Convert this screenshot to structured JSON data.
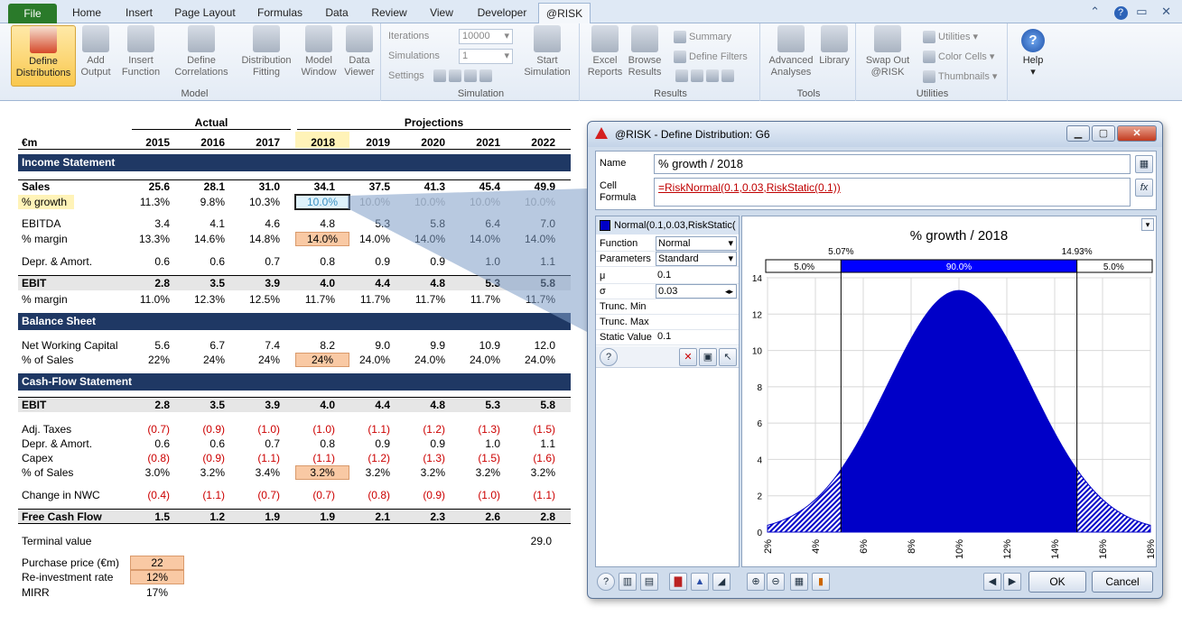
{
  "ribbon": {
    "tabs": [
      "File",
      "Home",
      "Insert",
      "Page Layout",
      "Formulas",
      "Data",
      "Review",
      "View",
      "Developer",
      "@RISK"
    ],
    "groups": {
      "model": {
        "label": "Model",
        "define_distributions": "Define Distributions",
        "add_output": "Add Output",
        "insert_function": "Insert Function",
        "define_correlations": "Define Correlations",
        "distribution_fitting": "Distribution Fitting",
        "model_window": "Model Window",
        "data_viewer": "Data Viewer"
      },
      "simulation": {
        "label": "Simulation",
        "iterations_label": "Iterations",
        "iterations_value": "10000",
        "simulations_label": "Simulations",
        "simulations_value": "1",
        "settings_label": "Settings",
        "start_simulation": "Start Simulation"
      },
      "results": {
        "label": "Results",
        "excel_reports": "Excel Reports",
        "browse_results": "Browse Results",
        "summary": "Summary",
        "define_filters": "Define Filters"
      },
      "tools": {
        "label": "Tools",
        "advanced_analyses": "Advanced Analyses",
        "library": "Library"
      },
      "utilities": {
        "label": "Utilities",
        "swap_out": "Swap Out @RISK",
        "utilities": "Utilities",
        "color_cells": "Color Cells",
        "thumbnails": "Thumbnails"
      },
      "help": {
        "label": "Help"
      }
    }
  },
  "sheet": {
    "header_actual": "Actual",
    "header_projections": "Projections",
    "unit": "€m",
    "years": [
      "2015",
      "2016",
      "2017",
      "2018",
      "2019",
      "2020",
      "2021",
      "2022"
    ],
    "income_statement": "Income Statement",
    "sales": {
      "label": "Sales",
      "values": [
        "25.6",
        "28.1",
        "31.0",
        "34.1",
        "37.5",
        "41.3",
        "45.4",
        "49.9"
      ]
    },
    "growth": {
      "label": "% growth",
      "values": [
        "11.3%",
        "9.8%",
        "10.3%",
        "10.0%",
        "10.0%",
        "10.0%",
        "10.0%",
        "10.0%"
      ]
    },
    "ebitda": {
      "label": "EBITDA",
      "values": [
        "3.4",
        "4.1",
        "4.6",
        "4.8",
        "5.3",
        "5.8",
        "6.4",
        "7.0"
      ]
    },
    "ebitda_margin": {
      "label": "% margin",
      "values": [
        "13.3%",
        "14.6%",
        "14.8%",
        "14.0%",
        "14.0%",
        "14.0%",
        "14.0%",
        "14.0%"
      ]
    },
    "depr": {
      "label": "Depr. & Amort.",
      "values": [
        "0.6",
        "0.6",
        "0.7",
        "0.8",
        "0.9",
        "0.9",
        "1.0",
        "1.1"
      ]
    },
    "ebit": {
      "label": "EBIT",
      "values": [
        "2.8",
        "3.5",
        "3.9",
        "4.0",
        "4.4",
        "4.8",
        "5.3",
        "5.8"
      ]
    },
    "ebit_margin": {
      "label": "% margin",
      "values": [
        "11.0%",
        "12.3%",
        "12.5%",
        "11.7%",
        "11.7%",
        "11.7%",
        "11.7%",
        "11.7%"
      ]
    },
    "balance_sheet": "Balance Sheet",
    "nwc": {
      "label": "Net Working Capital",
      "values": [
        "5.6",
        "6.7",
        "7.4",
        "8.2",
        "9.0",
        "9.9",
        "10.9",
        "12.0"
      ]
    },
    "nwc_pct": {
      "label": "% of Sales",
      "values": [
        "22%",
        "24%",
        "24%",
        "24%",
        "24.0%",
        "24.0%",
        "24.0%",
        "24.0%"
      ]
    },
    "cash_flow_statement": "Cash-Flow Statement",
    "cf_ebit": {
      "label": "EBIT",
      "values": [
        "2.8",
        "3.5",
        "3.9",
        "4.0",
        "4.4",
        "4.8",
        "5.3",
        "5.8"
      ]
    },
    "adj_taxes": {
      "label": "Adj. Taxes",
      "values": [
        "(0.7)",
        "(0.9)",
        "(1.0)",
        "(1.0)",
        "(1.1)",
        "(1.2)",
        "(1.3)",
        "(1.5)"
      ]
    },
    "cf_depr": {
      "label": "Depr. & Amort.",
      "values": [
        "0.6",
        "0.6",
        "0.7",
        "0.8",
        "0.9",
        "0.9",
        "1.0",
        "1.1"
      ]
    },
    "capex": {
      "label": "Capex",
      "values": [
        "(0.8)",
        "(0.9)",
        "(1.1)",
        "(1.1)",
        "(1.2)",
        "(1.3)",
        "(1.5)",
        "(1.6)"
      ]
    },
    "capex_pct": {
      "label": "% of Sales",
      "values": [
        "3.0%",
        "3.2%",
        "3.4%",
        "3.2%",
        "3.2%",
        "3.2%",
        "3.2%",
        "3.2%"
      ]
    },
    "change_nwc": {
      "label": "Change in NWC",
      "values": [
        "(0.4)",
        "(1.1)",
        "(0.7)",
        "(0.7)",
        "(0.8)",
        "(0.9)",
        "(1.0)",
        "(1.1)"
      ]
    },
    "fcf": {
      "label": "Free Cash Flow",
      "values": [
        "1.5",
        "1.2",
        "1.9",
        "1.9",
        "2.1",
        "2.3",
        "2.6",
        "2.8"
      ]
    },
    "terminal_value": {
      "label": "Terminal value",
      "value": "29.0"
    },
    "purchase_price": {
      "label": "Purchase price (€m)",
      "value": "22"
    },
    "reinvestment_rate": {
      "label": "Re-investment rate",
      "value": "12%"
    },
    "mirr": {
      "label": "MIRR",
      "value": "17%"
    }
  },
  "dialog": {
    "title": "@RISK - Define Distribution: G6",
    "name_label": "Name",
    "name_value": "% growth / 2018",
    "formula_label": "Cell Formula",
    "formula_value": "=RiskNormal(0.1,0.03,RiskStatic(0.1))",
    "dist_header": "Normal(0.1,0.03,RiskStatic(",
    "params": {
      "function_label": "Function",
      "function_value": "Normal",
      "parameters_label": "Parameters",
      "parameters_value": "Standard",
      "mu_label": "μ",
      "mu_value": "0.1",
      "sigma_label": "σ",
      "sigma_value": "0.03",
      "trunc_min_label": "Trunc. Min",
      "trunc_min_value": "",
      "trunc_max_label": "Trunc. Max",
      "trunc_max_value": "",
      "static_label": "Static Value",
      "static_value": "0.1"
    },
    "ok": "OK",
    "cancel": "Cancel"
  },
  "chart_data": {
    "type": "area",
    "title": "% growth / 2018",
    "distribution": "Normal",
    "mu": 0.1,
    "sigma": 0.03,
    "x_range": [
      0.02,
      0.18
    ],
    "ylim": [
      0,
      14
    ],
    "y_ticks": [
      "0",
      "2",
      "4",
      "6",
      "8",
      "10",
      "12",
      "14"
    ],
    "x_ticks": [
      "2%",
      "4%",
      "6%",
      "8%",
      "10%",
      "12%",
      "14%",
      "16%",
      "18%"
    ],
    "x_tick_values": [
      0.02,
      0.04,
      0.06,
      0.08,
      0.1,
      0.12,
      0.14,
      0.16,
      0.18
    ],
    "delimiters": {
      "left": 0.0507,
      "right": 0.1493,
      "left_label": "5.07%",
      "right_label": "14.93%"
    },
    "bands": {
      "left": "5.0%",
      "middle": "90.0%",
      "right": "5.0%"
    },
    "grid": true,
    "colors": {
      "fill": "#0000c8",
      "band": "#0000ff"
    }
  }
}
